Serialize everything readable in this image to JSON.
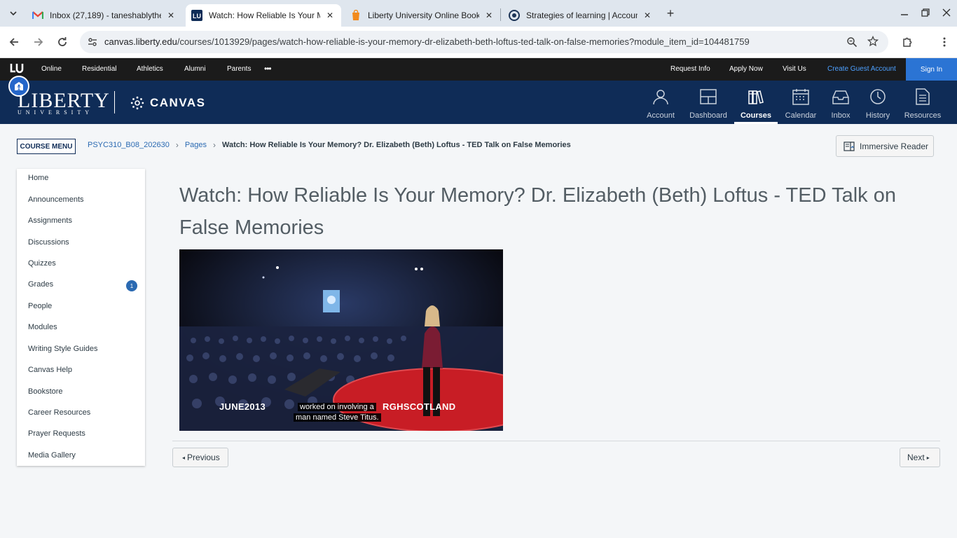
{
  "browser": {
    "tabs": [
      {
        "title": "Inbox (27,189) - taneshablythe",
        "favicon": "gmail-icon",
        "active": false
      },
      {
        "title": "Watch: How Reliable Is Your Me",
        "favicon": "liberty-icon",
        "active": true
      },
      {
        "title": "Liberty University Online Books",
        "favicon": "bookstore-icon",
        "active": false
      },
      {
        "title": "Strategies of learning | Account",
        "favicon": "openai-icon",
        "active": false
      }
    ],
    "address": {
      "host": "canvas.liberty.edu",
      "path": "/courses/1013929/pages/watch-how-reliable-is-your-memory-dr-elizabeth-beth-loftus-ted-talk-on-false-memories?module_item_id=104481759"
    }
  },
  "lu_topbar": {
    "left_links": [
      "Online",
      "Residential",
      "Athletics",
      "Alumni",
      "Parents"
    ],
    "more": "•••",
    "right_links": [
      "Request Info",
      "Apply Now",
      "Visit Us"
    ],
    "create_account": "Create Guest Account",
    "sign_in": "Sign In"
  },
  "brand": {
    "liberty": "LIBERTY",
    "university": "UNIVERSITY",
    "canvas": "CANVAS"
  },
  "global_nav": [
    {
      "label": "Account",
      "icon": "account-icon"
    },
    {
      "label": "Dashboard",
      "icon": "dashboard-icon"
    },
    {
      "label": "Courses",
      "icon": "courses-icon",
      "active": true
    },
    {
      "label": "Calendar",
      "icon": "calendar-icon"
    },
    {
      "label": "Inbox",
      "icon": "inbox-icon"
    },
    {
      "label": "History",
      "icon": "history-icon"
    },
    {
      "label": "Resources",
      "icon": "resources-icon"
    }
  ],
  "course_menu_button": "COURSE MENU",
  "breadcrumb": {
    "course": "PSYC310_B08_202630",
    "section": "Pages",
    "current": "Watch: How Reliable Is Your Memory? Dr. Elizabeth (Beth) Loftus - TED Talk on False Memories"
  },
  "immersive_reader": "Immersive Reader",
  "course_nav": {
    "items": [
      {
        "label": "Home"
      },
      {
        "label": "Announcements"
      },
      {
        "label": "Assignments"
      },
      {
        "label": "Discussions"
      },
      {
        "label": "Quizzes"
      },
      {
        "label": "Grades",
        "badge": "1"
      },
      {
        "label": "People"
      },
      {
        "label": "Modules"
      },
      {
        "label": "Writing Style Guides"
      },
      {
        "label": "Canvas Help"
      },
      {
        "label": "Bookstore"
      },
      {
        "label": "Career Resources"
      },
      {
        "label": "Prayer Requests"
      },
      {
        "label": "Media Gallery"
      }
    ]
  },
  "page": {
    "title": "Watch: How Reliable Is Your Memory? Dr. Elizabeth (Beth) Loftus - TED Talk on False Memories"
  },
  "video": {
    "overlay_left": "JUNE2013",
    "overlay_right": "RGHSCOTLAND",
    "caption_line1": "worked on involving a",
    "caption_line2": "man named Steve Titus."
  },
  "pager": {
    "previous": "Previous",
    "next": "Next"
  },
  "colors": {
    "header_navy": "#0f2c57",
    "link_blue": "#2b6ab2",
    "signin_blue": "#2b74d4"
  }
}
